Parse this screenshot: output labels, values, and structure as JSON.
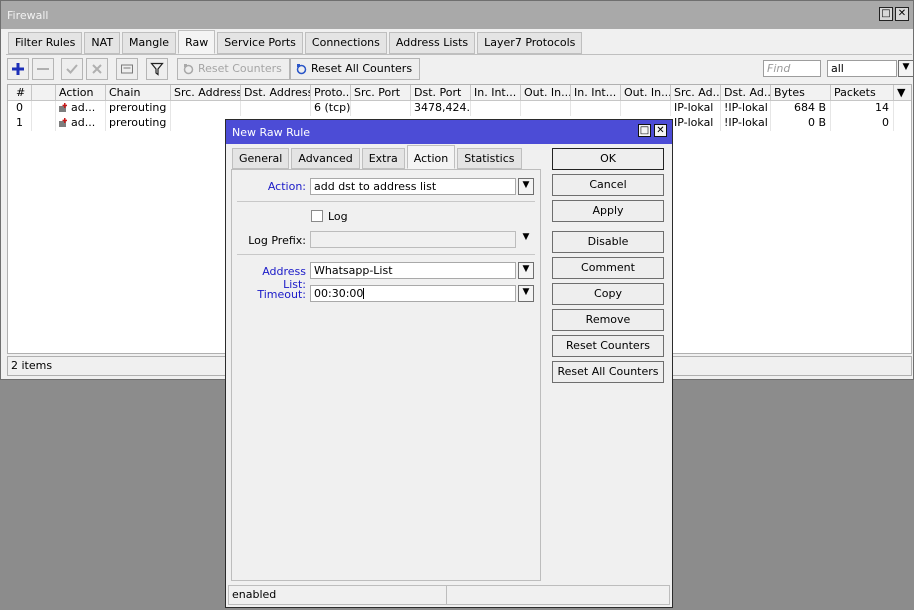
{
  "firewall": {
    "title": "Firewall",
    "tabs": [
      "Filter Rules",
      "NAT",
      "Mangle",
      "Raw",
      "Service Ports",
      "Connections",
      "Address Lists",
      "Layer7 Protocols"
    ],
    "active_tab": "Raw",
    "toolbar": {
      "reset_counters": "Reset Counters",
      "reset_all_counters": "Reset All Counters",
      "find_placeholder": "Find",
      "filter_value": "all"
    },
    "columns": [
      "#",
      "Action",
      "Chain",
      "Src. Address",
      "Dst. Address",
      "Proto...",
      "Src. Port",
      "Dst. Port",
      "In. Int...",
      "Out. In...",
      "In. Int...",
      "Out. In...",
      "Src. Ad...",
      "Dst. Ad...",
      "Bytes",
      "Packets"
    ],
    "rows": [
      {
        "num": "0",
        "action": "ad...",
        "chain": "prerouting",
        "proto": "6 (tcp)",
        "dst_port": "3478,424...",
        "src_ad": "IP-lokal",
        "dst_ad": "!IP-lokal",
        "bytes": "684 B",
        "packets": "14"
      },
      {
        "num": "1",
        "action": "ad...",
        "chain": "prerouting",
        "proto": "",
        "dst_port": "",
        "src_ad": "IP-lokal",
        "dst_ad": "!IP-lokal",
        "bytes": "0 B",
        "packets": "0"
      }
    ],
    "status": "2 items"
  },
  "dialog": {
    "title": "New Raw Rule",
    "tabs": [
      "General",
      "Advanced",
      "Extra",
      "Action",
      "Statistics"
    ],
    "active_tab": "Action",
    "fields": {
      "action_label": "Action:",
      "action_value": "add dst to address list",
      "log_label": "Log",
      "log_prefix_label": "Log Prefix:",
      "log_prefix_value": "",
      "address_list_label": "Address List:",
      "address_list_value": "Whatsapp-List",
      "timeout_label": "Timeout:",
      "timeout_value": "00:30:00"
    },
    "buttons": [
      "OK",
      "Cancel",
      "Apply",
      "Disable",
      "Comment",
      "Copy",
      "Remove",
      "Reset Counters",
      "Reset All Counters"
    ],
    "status": "enabled"
  },
  "colors": {
    "dialog_title_bg": "#4c4cd6",
    "firewall_title_bg": "#a9a9a9",
    "label_blue": "#1a1ac8"
  }
}
